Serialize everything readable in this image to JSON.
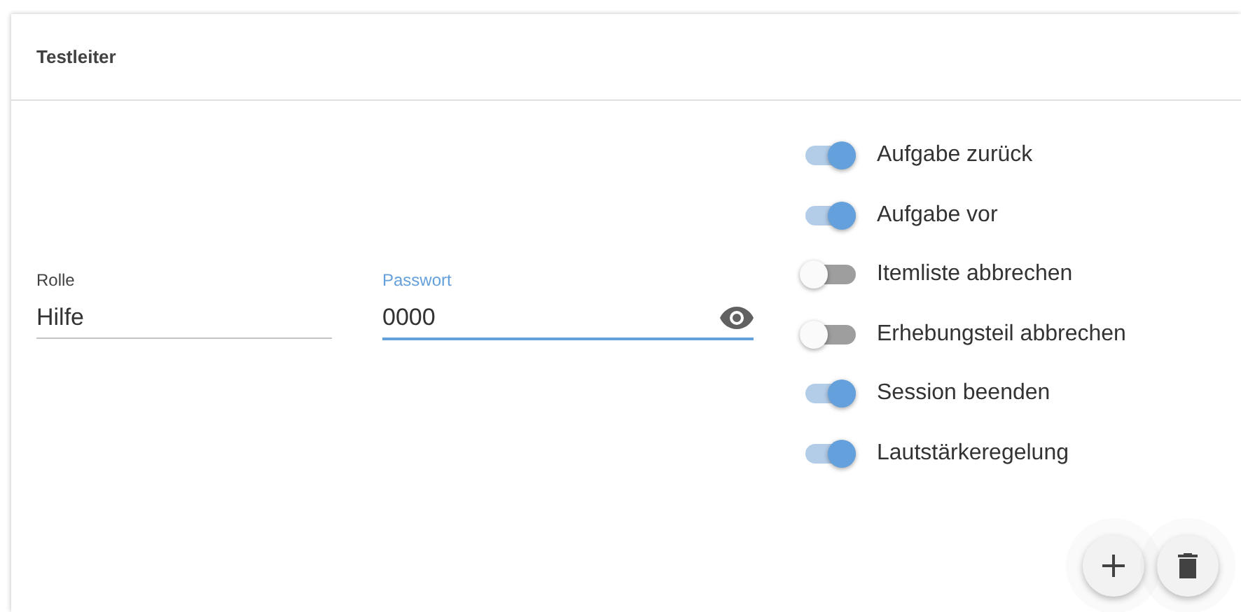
{
  "card": {
    "title": "Testleiter"
  },
  "fields": [
    {
      "label": "Rolle",
      "value": "Hilfe",
      "focused": false,
      "kind": "text"
    },
    {
      "label": "Passwort",
      "value": "0000",
      "focused": true,
      "kind": "password"
    }
  ],
  "toggles": [
    {
      "label": "Aufgabe zurück",
      "on": true
    },
    {
      "label": "Aufgabe vor",
      "on": true
    },
    {
      "label": "Itemliste abbrechen",
      "on": false
    },
    {
      "label": "Erhebungsteil abbrechen",
      "on": false
    },
    {
      "label": "Session beenden",
      "on": true
    },
    {
      "label": "Lautstärkeregelung",
      "on": true
    }
  ],
  "actions": [
    {
      "kind": "add"
    },
    {
      "kind": "delete"
    }
  ]
}
